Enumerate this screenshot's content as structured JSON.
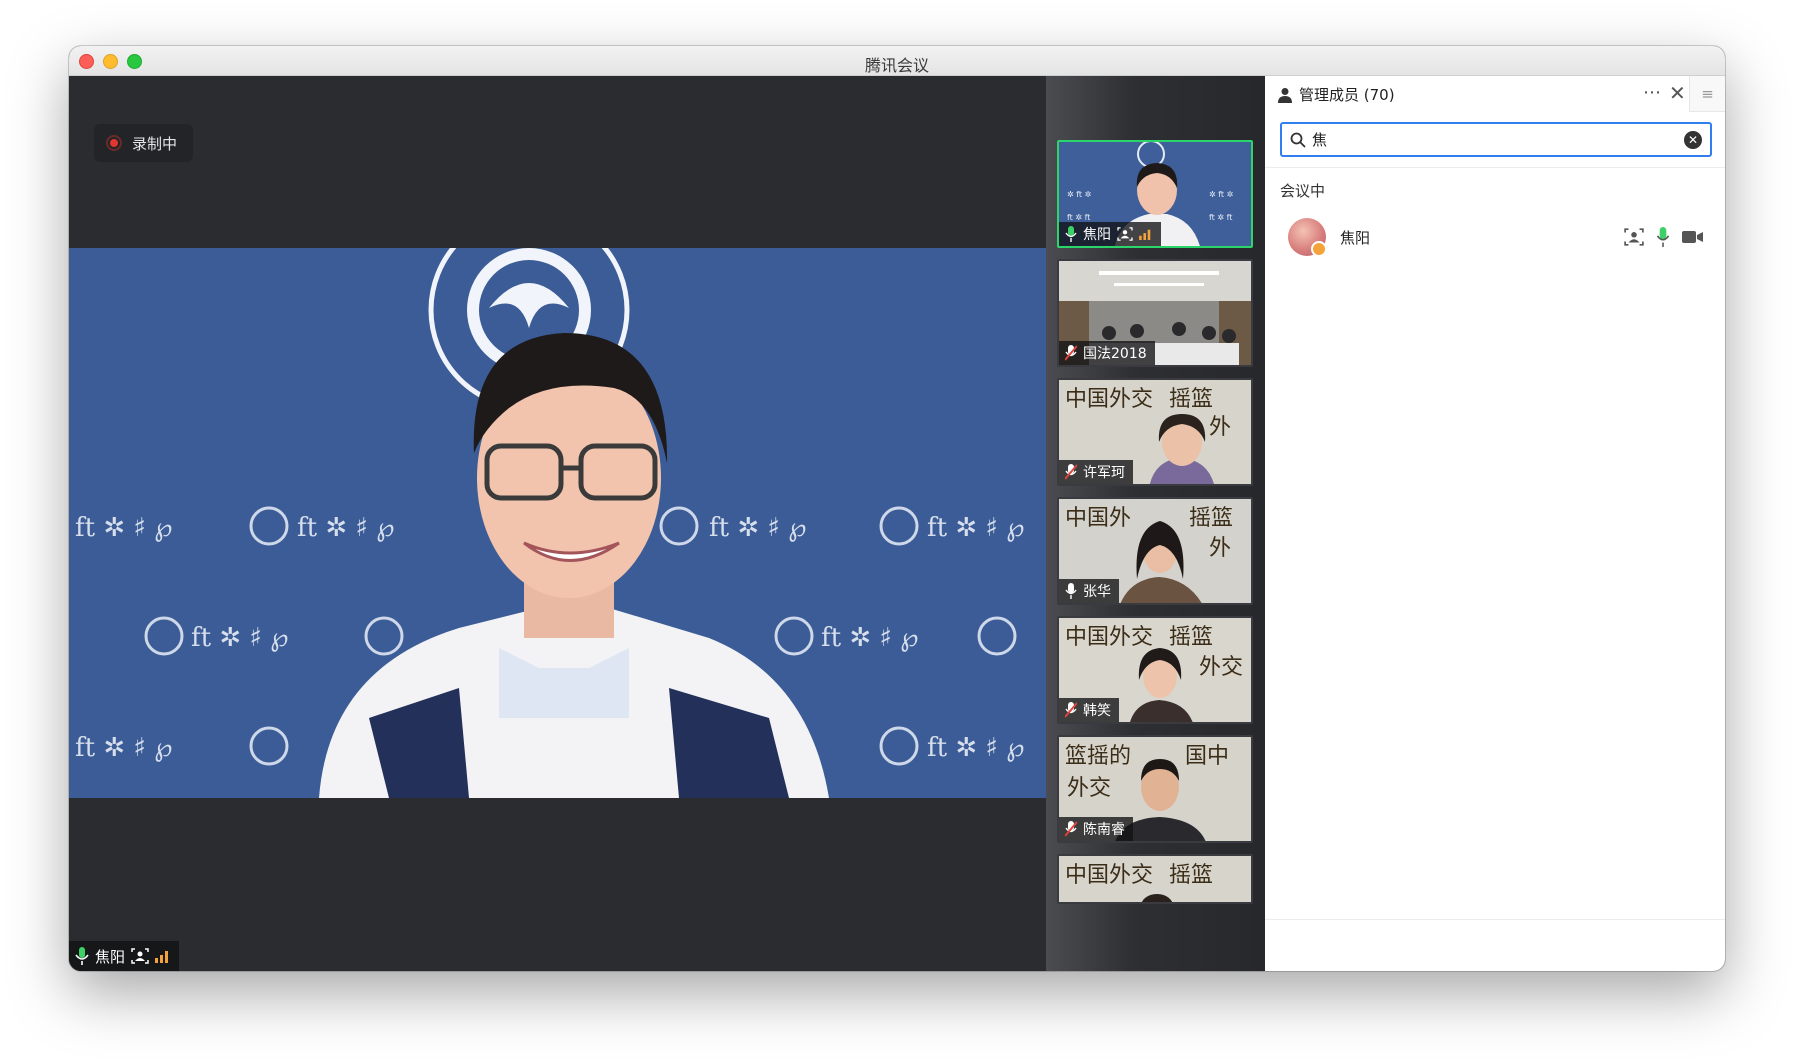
{
  "window": {
    "title": "腾讯会议"
  },
  "stage": {
    "recording_label": "录制中",
    "main_speaker": "焦阳"
  },
  "thumbnails": [
    {
      "name": "焦阳",
      "mic": "on",
      "active": true
    },
    {
      "name": "国法2018",
      "mic": "muted",
      "active": false
    },
    {
      "name": "许军珂",
      "mic": "muted",
      "active": false
    },
    {
      "name": "张华",
      "mic": "on",
      "active": false
    },
    {
      "name": "韩笑",
      "mic": "muted",
      "active": false
    },
    {
      "name": "陈南睿",
      "mic": "muted",
      "active": false
    },
    {
      "name": "",
      "mic": "",
      "active": false
    }
  ],
  "panel": {
    "title": "管理成员 (70)",
    "search_value": "焦",
    "section_label": "会议中",
    "members": [
      {
        "name": "焦阳"
      }
    ]
  },
  "colors": {
    "active_border": "#2bd56a",
    "search_border": "#2f7ff0",
    "record_dot": "#e0362f",
    "mic_on": "#3cd166",
    "mic_muted": "#e0443d"
  },
  "icons": [
    "person-icon",
    "more-icon",
    "close-icon",
    "menu-icon",
    "search-icon",
    "clear-icon",
    "mic-icon",
    "mic-muted-icon",
    "camera-icon",
    "screen-share-icon",
    "signal-icon",
    "record-icon"
  ]
}
